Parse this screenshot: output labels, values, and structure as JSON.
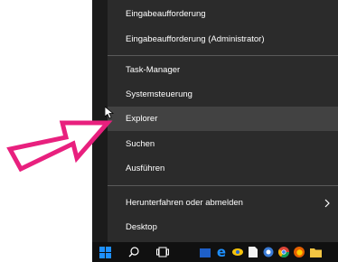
{
  "menu": {
    "items": [
      {
        "label": "Eingabeaufforderung"
      },
      {
        "label": "Eingabeaufforderung (Administrator)"
      },
      {
        "label": "Task-Manager"
      },
      {
        "label": "Systemsteuerung"
      },
      {
        "label": "Explorer"
      },
      {
        "label": "Suchen"
      },
      {
        "label": "Ausführen"
      },
      {
        "label": "Herunterfahren oder abmelden"
      },
      {
        "label": "Desktop"
      }
    ]
  },
  "colors": {
    "menu_bg": "#2b2b2b",
    "highlight_bg": "#424242",
    "arrow": "#e8207e",
    "taskbar": "#101010",
    "windows_blue": "#1e90ff"
  },
  "taskbar": {
    "icons": [
      "windows-logo-icon",
      "search-icon",
      "task-view-icon",
      "store-icon",
      "edge-icon",
      "app-icon",
      "file-icon",
      "network-icon",
      "chrome-icon",
      "firefox-icon",
      "folder-icon"
    ]
  }
}
